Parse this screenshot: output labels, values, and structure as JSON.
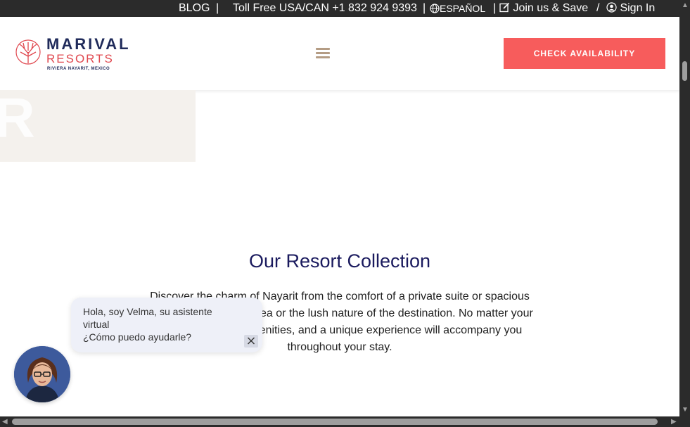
{
  "topbar": {
    "blog": "BLOG",
    "toll_free": "Toll Free USA/CAN +1 832 924 9393",
    "language": "ESPAÑOL",
    "join": "Join us & Save",
    "divider": "/",
    "sign_in": "Sign In",
    "bar_sep": "|"
  },
  "header": {
    "logo_wordmark": "MARIVAL",
    "logo_sub": "RESORTS",
    "logo_tag": "RIVIERA NAYARIT, MEXICO",
    "cta_label": "CHECK AVAILABILITY"
  },
  "section": {
    "title": "Our Resort Collection",
    "description": "Discover the charm of Nayarit from the comfort of a private suite or spacious villa with views of the sea or the lush nature of the destination. No matter your choice, premiere amenities, and a unique experience will accompany you throughout your stay."
  },
  "chat": {
    "line1": "Hola, soy Velma, su asistente virtual",
    "line2": "¿Cómo puedo ayudarle?"
  },
  "colors": {
    "accent": "#f75c5c",
    "navy": "#1a1a5e",
    "topbar": "#2b2b2b",
    "beige": "#f4f1ed"
  },
  "icons": [
    "globe-icon",
    "edit-icon",
    "user-icon",
    "menu-icon",
    "close-icon",
    "coral-logo-icon"
  ]
}
